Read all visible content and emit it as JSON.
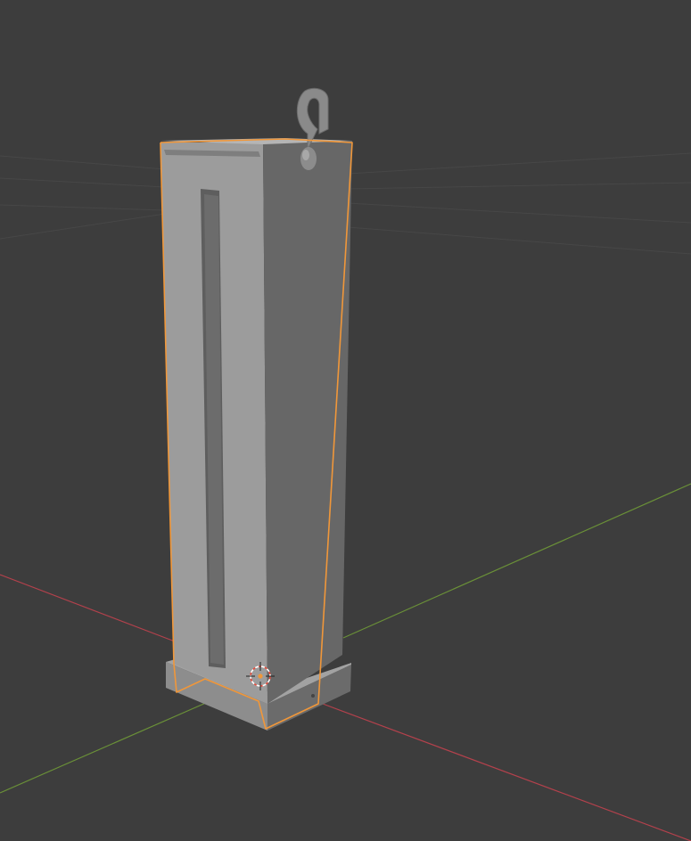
{
  "viewport": {
    "background": "#3d3d3d",
    "grid_color": "#474747",
    "x_axis_color": "#b3414c",
    "y_axis_color": "#6a9038",
    "selection_outline_color": "#f0973a"
  },
  "object": {
    "selected": true,
    "base_material_color": "#9a9a9a",
    "front_face_color": "#9b9b9b",
    "side_face_color": "#6a6a6a",
    "slot_color": "#5a5a5a"
  },
  "gizmos": {
    "cursor_icon": "3d-cursor-icon",
    "origin_icon": "object-origin-icon"
  }
}
